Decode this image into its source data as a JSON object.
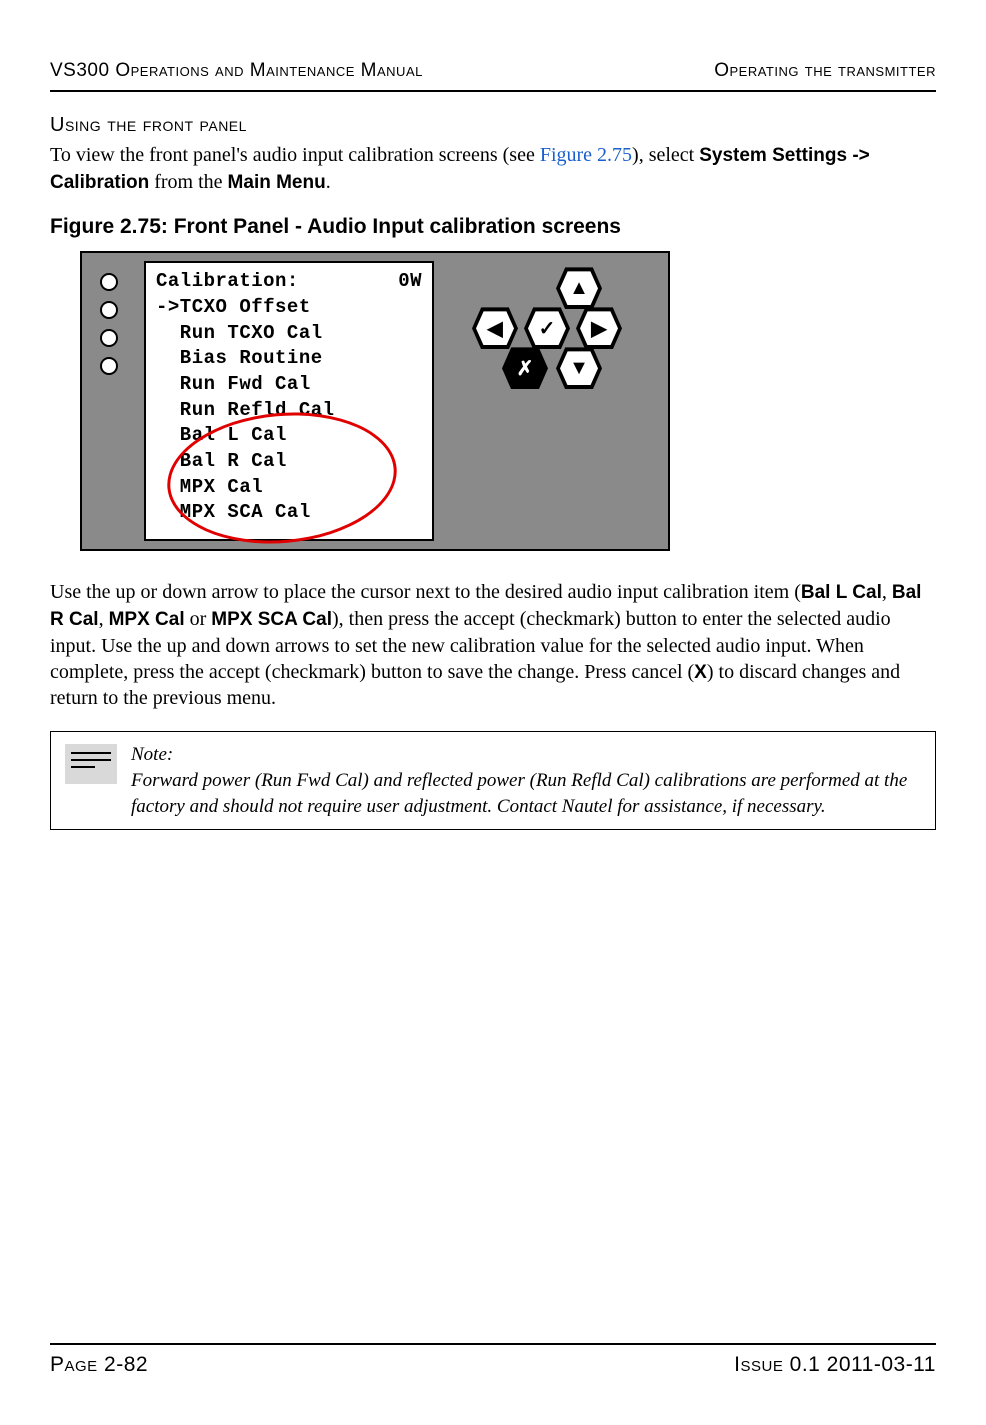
{
  "header": {
    "left": "VS300 Operations and Maintenance Manual",
    "right": "Operating the transmitter"
  },
  "section_heading": "Using the front panel",
  "intro": {
    "p1a": "To view the front panel's audio input calibration screens (see ",
    "figref": "Figure 2.75",
    "p1b": "), select ",
    "path": "System Settings -> Calibration",
    "p1c": " from the ",
    "menu": "Main Menu",
    "p1d": "."
  },
  "figure_title": "Figure 2.75: Front Panel - Audio Input calibration screens",
  "lcd": {
    "title": "Calibration:",
    "power": "0W",
    "items": [
      "->TCXO Offset",
      "  Run TCXO Cal",
      "  Bias Routine",
      "  Run Fwd Cal",
      "  Run Refld Cal",
      "  Bal L Cal",
      "  Bal R Cal",
      "  MPX Cal",
      "  MPX SCA Cal"
    ]
  },
  "dpad": {
    "up": "▲",
    "down": "▼",
    "left": "◀",
    "right": "▶",
    "ok": "✓",
    "cancel": "✗"
  },
  "para2": {
    "a": "Use the up or down arrow to place the cursor next to the desired audio input calibration item (",
    "b1": "Bal L Cal",
    "c1": ", ",
    "b2": "Bal R Cal",
    "c2": ", ",
    "b3": "MPX Cal",
    "c3": " or ",
    "b4": "MPX SCA Cal",
    "d": "), then press the accept (checkmark) button to enter the selected audio input. Use the up and down arrows to set the new calibration value for the selected audio input. When complete, press the accept (checkmark) button to save the change. Press cancel (",
    "x": "X",
    "e": ") to discard changes and return to the previous menu."
  },
  "note": {
    "label": "Note:",
    "text": "Forward power (Run Fwd Cal) and reflected power (Run Refld Cal) calibrations are performed at the factory and should not require user adjustment. Contact Nautel for assistance, if necessary."
  },
  "footer": {
    "left": "Page 2-82",
    "right": "Issue 0.1  2011-03-11"
  }
}
